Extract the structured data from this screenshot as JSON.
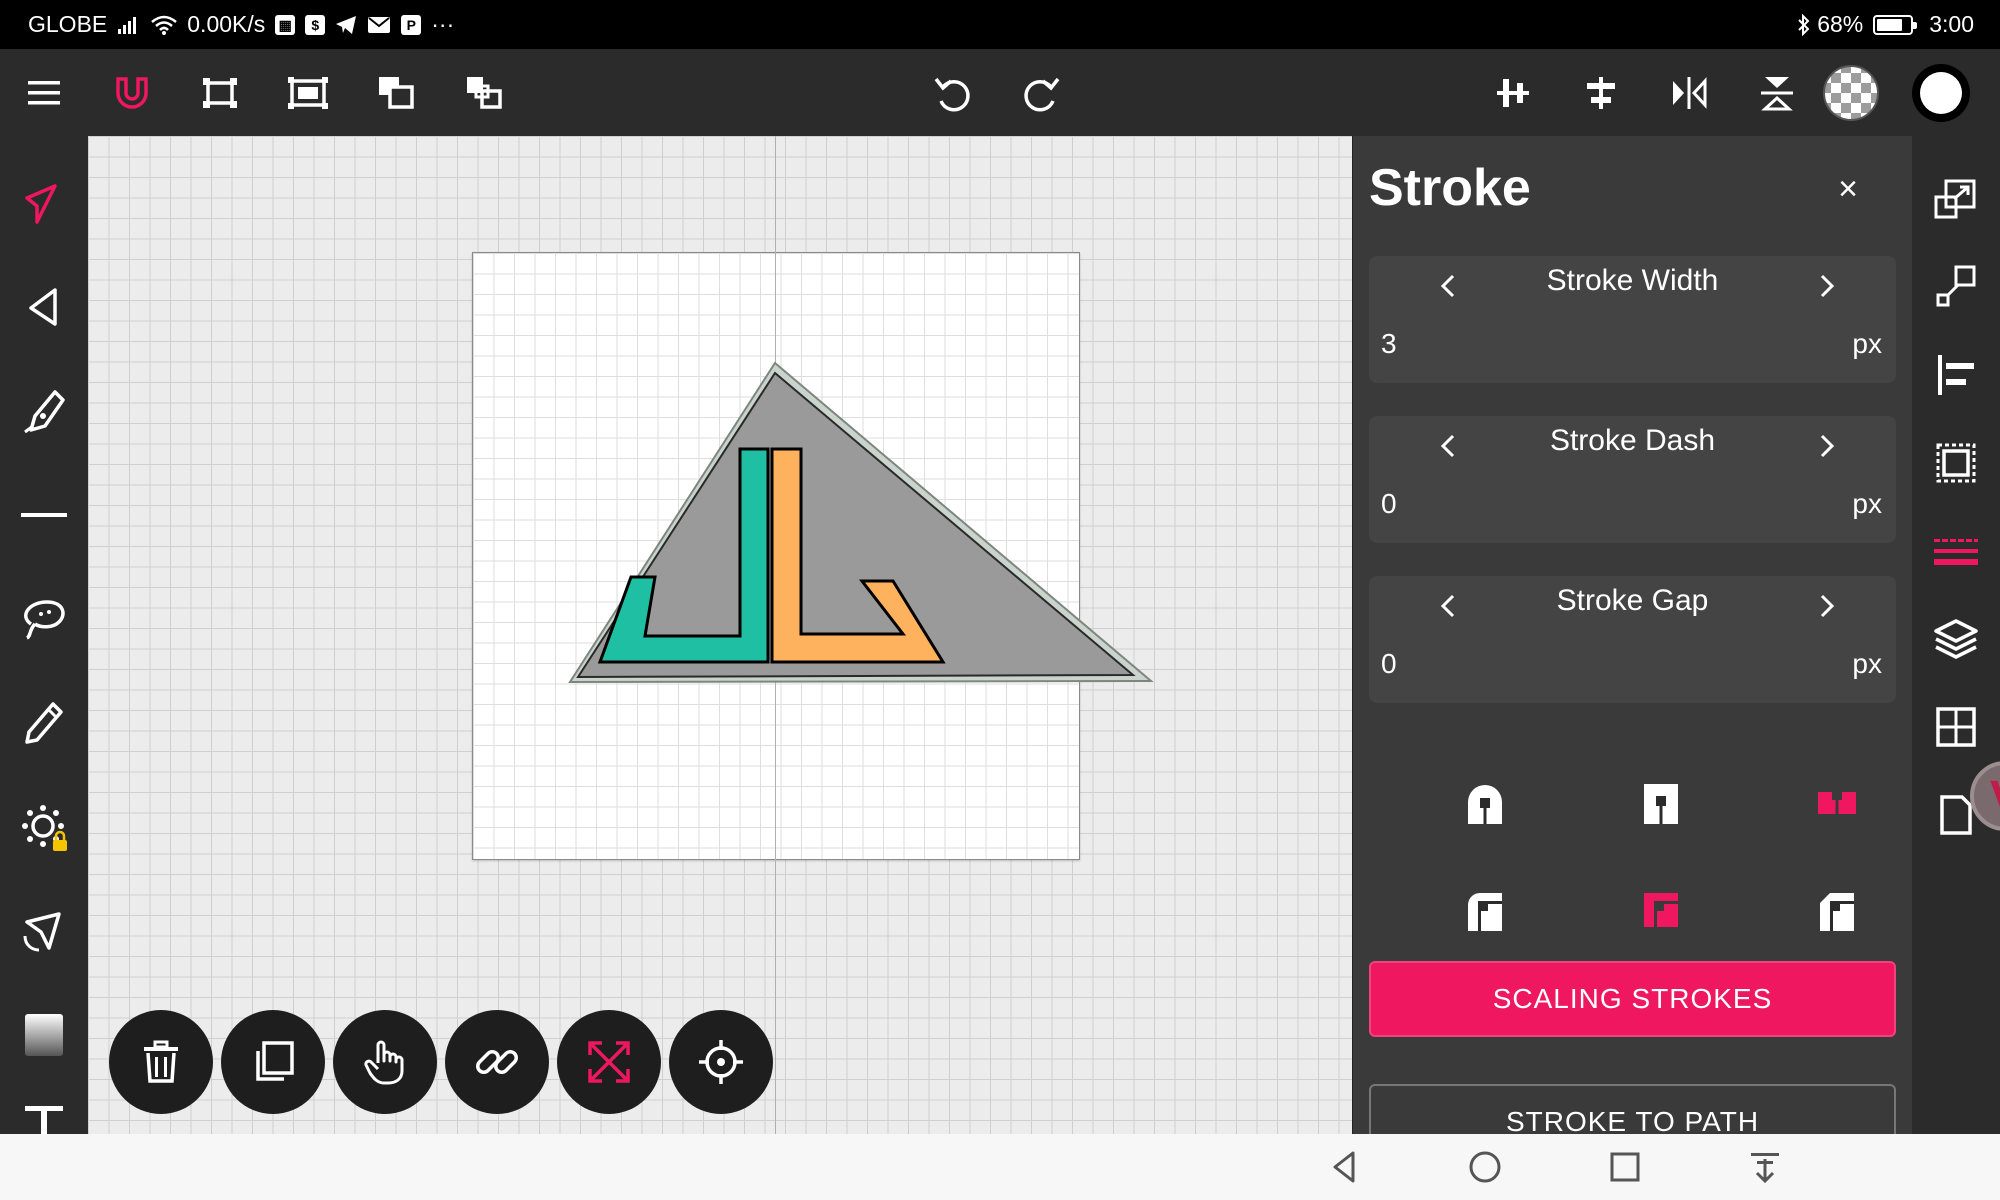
{
  "status_bar": {
    "carrier": "GLOBE",
    "net_speed": "0.00K/s",
    "overflow": "···",
    "battery_percent": "68%",
    "time": "3:00"
  },
  "toolbar": {
    "left_icons": [
      "menu-icon",
      "magnet-icon",
      "fit-selection-icon",
      "fit-artboard-icon",
      "arrange-front-icon",
      "arrange-back-icon"
    ],
    "center_icons": [
      "undo-icon",
      "redo-icon"
    ],
    "right_icons": [
      "align-vertical-center-icon",
      "align-horizontal-center-icon",
      "flip-horizontal-icon",
      "flip-vertical-icon",
      "fill-transparent-swatch",
      "stroke-color-swatch"
    ]
  },
  "left_tools": [
    "select-icon",
    "direct-select-icon",
    "pen-icon",
    "line-icon",
    "lasso-icon",
    "pencil-icon",
    "spiral-locked-icon",
    "node-pen-icon",
    "gradient-icon",
    "text-icon"
  ],
  "right_rail": [
    "resize-icon",
    "transform-icon",
    "align-icon",
    "boolean-icon",
    "stroke-icon",
    "layers-icon",
    "grid-icon",
    "page-icon"
  ],
  "panel": {
    "title": "Stroke",
    "close": "×",
    "properties": [
      {
        "label": "Stroke Width",
        "value": "3",
        "unit": "px"
      },
      {
        "label": "Stroke Dash",
        "value": "0",
        "unit": "px"
      },
      {
        "label": "Stroke Gap",
        "value": "0",
        "unit": "px"
      }
    ],
    "line_caps": [
      "round-cap",
      "butt-cap",
      "square-cap"
    ],
    "line_joins": [
      "round-join",
      "miter-join",
      "bevel-join"
    ],
    "selected_cap": "square-cap",
    "selected_join": "miter-join",
    "scaling_button": "SCALING STROKES",
    "stroke_to_path_button": "STROKE TO PATH"
  },
  "floating_actions": [
    "delete-icon",
    "duplicate-icon",
    "pan-hand-icon",
    "link-icon",
    "expand-icon",
    "center-target-icon"
  ],
  "colors": {
    "accent": "#ee1760",
    "logo_teal": "#1fbfa3",
    "logo_orange": "#ffb25e",
    "logo_grey": "#9a9a9a",
    "logo_outer": "#c9d4cc"
  }
}
